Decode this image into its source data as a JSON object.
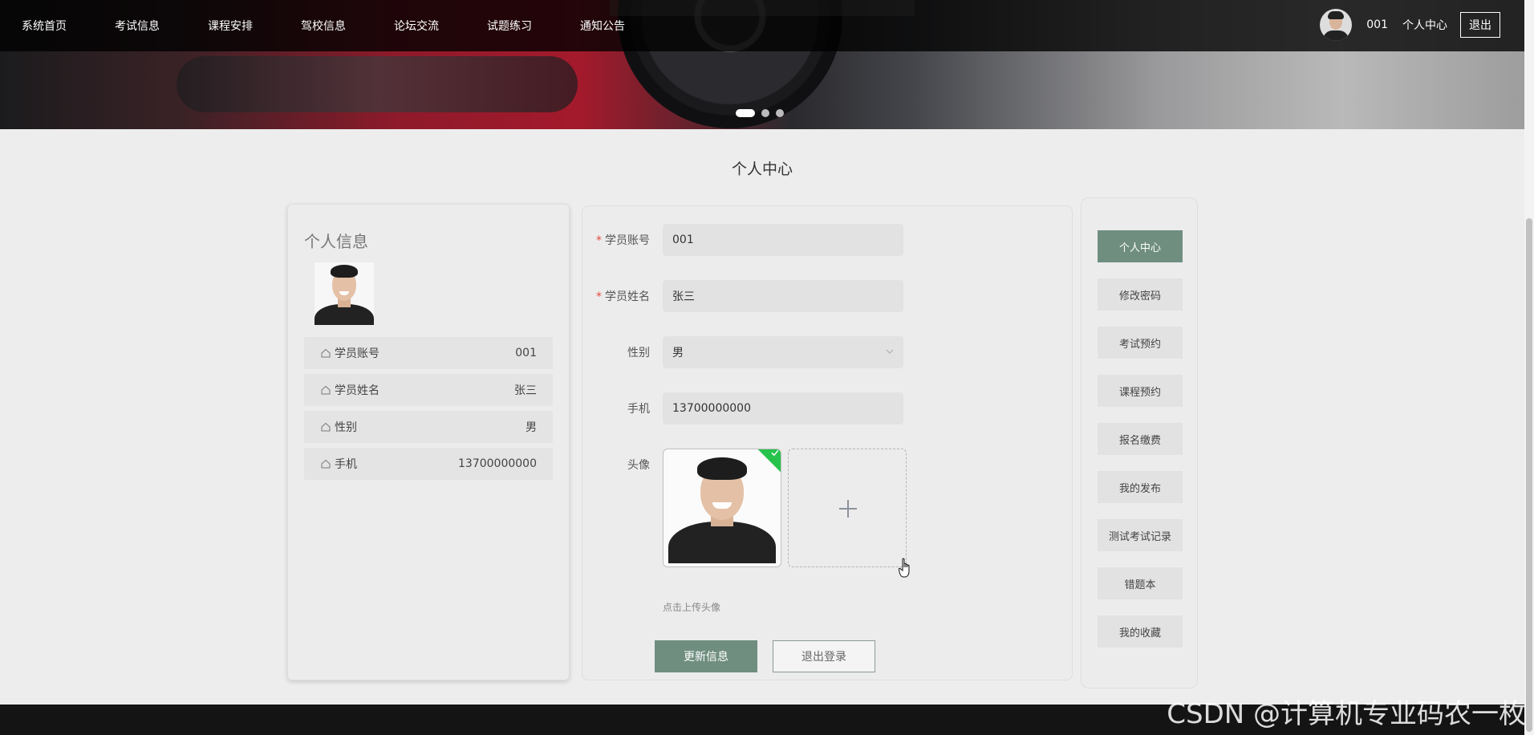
{
  "nav": {
    "items": [
      {
        "label": "系统首页"
      },
      {
        "label": "考试信息"
      },
      {
        "label": "课程安排"
      },
      {
        "label": "驾校信息"
      },
      {
        "label": "论坛交流"
      },
      {
        "label": "试题练习"
      },
      {
        "label": "通知公告"
      }
    ]
  },
  "user": {
    "name": "001",
    "center_label": "个人中心",
    "logout_label": "退出"
  },
  "page": {
    "title": "个人中心"
  },
  "profile": {
    "title": "个人信息",
    "rows": [
      {
        "label": "学员账号",
        "value": "001"
      },
      {
        "label": "学员姓名",
        "value": "张三"
      },
      {
        "label": "性别",
        "value": "男"
      },
      {
        "label": "手机",
        "value": "13700000000"
      }
    ]
  },
  "form": {
    "account_label": "学员账号",
    "account_value": "001",
    "name_label": "学员姓名",
    "name_value": "张三",
    "gender_label": "性别",
    "gender_value": "男",
    "phone_label": "手机",
    "phone_value": "13700000000",
    "avatar_label": "头像",
    "upload_tip": "点击上传头像",
    "update_button": "更新信息",
    "logout_button": "退出登录"
  },
  "menu": {
    "items": [
      {
        "label": "个人中心",
        "active": true
      },
      {
        "label": "修改密码"
      },
      {
        "label": "考试预约"
      },
      {
        "label": "课程预约"
      },
      {
        "label": "报名缴费"
      },
      {
        "label": "我的发布"
      },
      {
        "label": "测试考试记录"
      },
      {
        "label": "错题本"
      },
      {
        "label": "我的收藏"
      }
    ]
  },
  "colors": {
    "accent": "#6f8e80",
    "success": "#27c24c",
    "required": "#e5483a"
  },
  "carousel": {
    "count": 3,
    "active_index": 0
  },
  "watermark": "CSDN @计算机专业码农一枚"
}
